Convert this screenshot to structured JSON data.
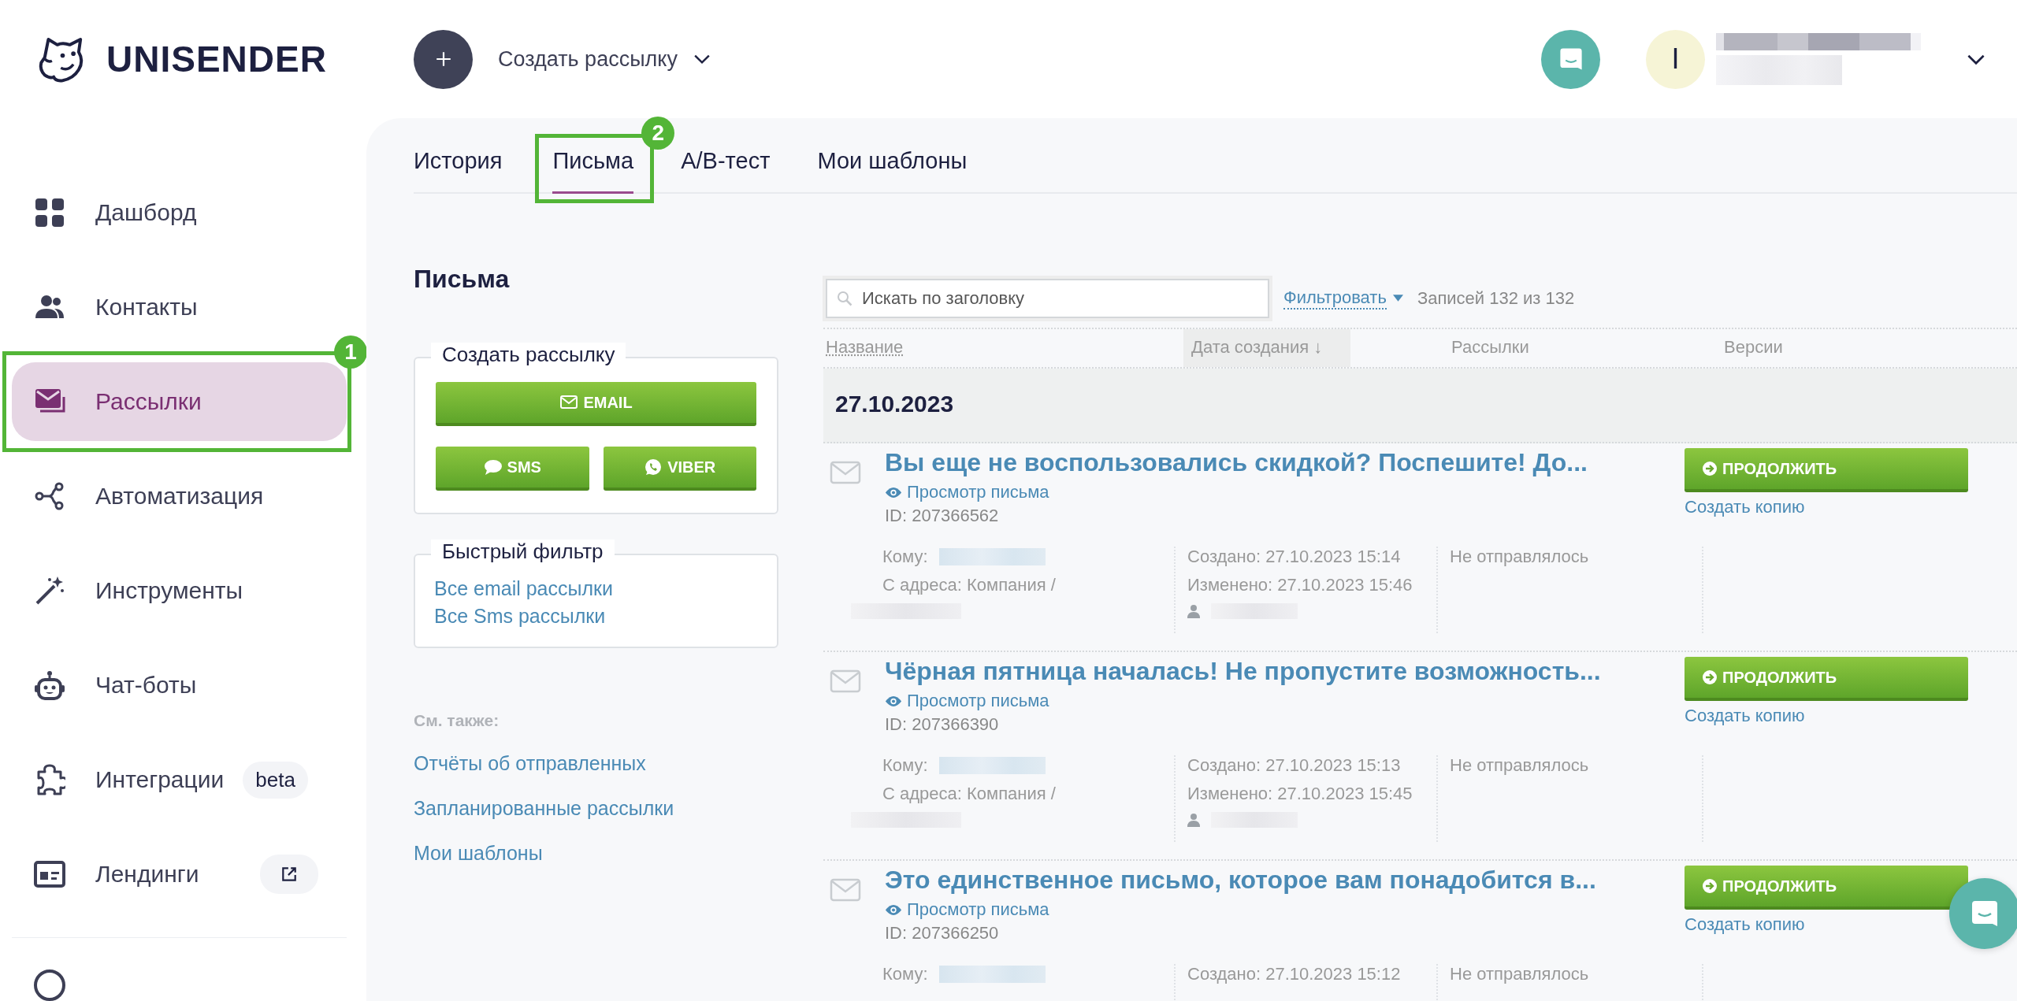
{
  "logo": {
    "text": "UNISENDER"
  },
  "header": {
    "create_label": "Создать рассылку",
    "user_initial": "I"
  },
  "sidebar": {
    "items": [
      {
        "label": "Дашборд",
        "selected": false
      },
      {
        "label": "Контакты",
        "selected": false
      },
      {
        "label": "Рассылки",
        "selected": true,
        "callout": "1"
      },
      {
        "label": "Автоматизация",
        "selected": false
      },
      {
        "label": "Инструменты",
        "selected": false
      },
      {
        "label": "Чат-боты",
        "selected": false
      },
      {
        "label": "Интеграции",
        "selected": false,
        "badge": "beta"
      },
      {
        "label": "Лендинги",
        "selected": false,
        "external": true
      }
    ]
  },
  "tabs": [
    {
      "label": "История",
      "selected": false
    },
    {
      "label": "Письма",
      "selected": true,
      "callout": "2"
    },
    {
      "label": "А/В-тест",
      "selected": false
    },
    {
      "label": "Мои шаблоны",
      "selected": false
    }
  ],
  "left": {
    "title": "Письма",
    "create_group": {
      "legend": "Создать рассылку",
      "buttons": [
        {
          "label": "EMAIL",
          "kind": "email"
        },
        {
          "label": "SMS",
          "kind": "sms"
        },
        {
          "label": "VIBER",
          "kind": "viber"
        }
      ]
    },
    "quick_filter": {
      "legend": "Быстрый фильтр",
      "links": [
        "Все email рассылки",
        "Все Sms рассылки"
      ]
    },
    "see_also": {
      "title": "См. также:",
      "links": [
        "Отчёты об отправленных",
        "Запланированные рассылки",
        "Мои шаблоны"
      ]
    }
  },
  "list": {
    "search": {
      "placeholder": "Искать по заголовку"
    },
    "filter_link": "Фильтровать",
    "count": "Записей 132 из 132",
    "columns": [
      {
        "label": "Название",
        "sorted": false
      },
      {
        "label": "Дата создания ↓",
        "sorted": true
      },
      {
        "label": "Рассылки",
        "sorted": false
      },
      {
        "label": "Версии",
        "sorted": false
      }
    ],
    "groups": [
      {
        "date": "27.10.2023",
        "items": [
          {
            "title": "Вы еще не воспользовались скидкой? Поспешите! До...",
            "preview_link": "Просмотр письма",
            "id": "ID: 207366562",
            "to_label": "Кому:",
            "from_label": "С адреса: Компания /",
            "created": "Создано: 27.10.2023 15:14",
            "modified": "Изменено: 27.10.2023 15:46",
            "status": "Не отправлялось",
            "action": "ПРОДОЛЖИТЬ",
            "copy_link": "Создать копию"
          },
          {
            "title": "Чёрная пятница началась! Не пропустите возможность...",
            "preview_link": "Просмотр письма",
            "id": "ID: 207366390",
            "to_label": "Кому:",
            "from_label": "С адреса: Компания /",
            "created": "Создано: 27.10.2023 15:13",
            "modified": "Изменено: 27.10.2023 15:45",
            "status": "Не отправлялось",
            "action": "ПРОДОЛЖИТЬ",
            "copy_link": "Создать копию"
          },
          {
            "title": "Это единственное письмо, которое вам понадобится в...",
            "preview_link": "Просмотр письма",
            "id": "ID: 207366250",
            "to_label": "Кому:",
            "created": "Создано: 27.10.2023 15:12",
            "status": "Не отправлялось",
            "action": "ПРОДОЛЖИТЬ",
            "copy_link": "Создать копию"
          }
        ]
      }
    ]
  }
}
